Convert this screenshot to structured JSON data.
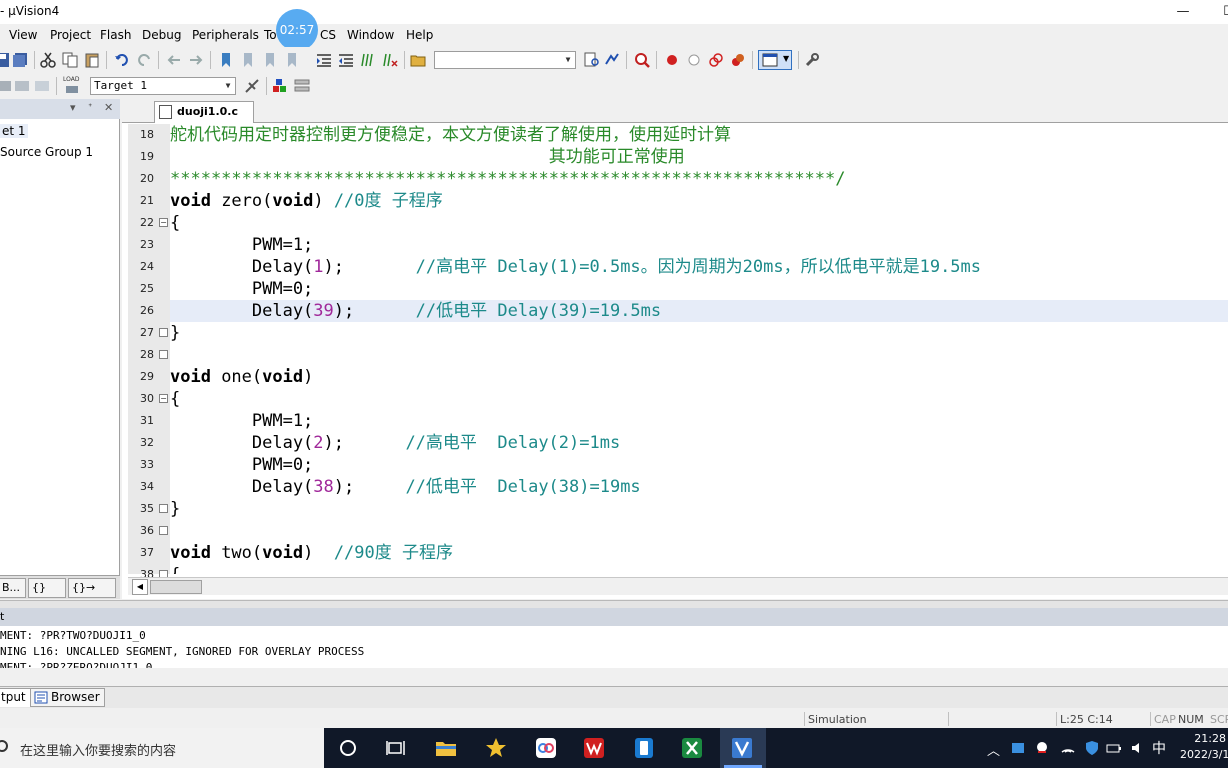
{
  "window": {
    "title": "- µVision4",
    "minimize": "—",
    "maximize": "☐"
  },
  "menu": [
    "View",
    "Project",
    "Flash",
    "Debug",
    "Peripherals",
    "To",
    "CS",
    "Window",
    "Help"
  ],
  "timer_badge": "02:57",
  "toolbar2": {
    "target_combo": "Target 1",
    "load_label": "LOAD"
  },
  "project_panel": {
    "tree": [
      "et 1",
      "Source Group 1"
    ],
    "tabs": [
      "B...",
      "{} F...",
      "{}→ Te..."
    ]
  },
  "editor": {
    "file_tab": "duoji1.0.c",
    "lines": [
      {
        "num": "18",
        "text": "舵机代码用定时器控制更方便稳定，本文方便读者了解使用，使用延时计算",
        "kind": "comment"
      },
      {
        "num": "19",
        "text": "                                     其功能可正常使用",
        "kind": "comment"
      },
      {
        "num": "20",
        "text": "*****************************************************************/",
        "kind": "comment"
      },
      {
        "num": "21",
        "code": [
          "void",
          " zero(",
          "void",
          ") "
        ],
        "tail": "//0度 子程序",
        "kind": "func"
      },
      {
        "num": "22",
        "text": "{",
        "kind": "plain"
      },
      {
        "num": "23",
        "text": "        PWM=1;",
        "kind": "plain"
      },
      {
        "num": "24",
        "text": "        Delay(1);       //高电平 Delay(1)=0.5ms。因为周期为20ms，所以低电平就是19.5ms",
        "kind": "plain"
      },
      {
        "num": "25",
        "text": "        PWM=0;",
        "kind": "plain"
      },
      {
        "num": "26",
        "text": "        Delay(39);      //低电平 Delay(39)=19.5ms",
        "kind": "plain"
      },
      {
        "num": "27",
        "text": "}",
        "kind": "plain"
      },
      {
        "num": "28",
        "text": "",
        "kind": "plain"
      },
      {
        "num": "29",
        "text": "void one(void)",
        "kind": "plain"
      },
      {
        "num": "30",
        "text": "{",
        "kind": "plain"
      },
      {
        "num": "31",
        "text": "        PWM=1;",
        "kind": "plain"
      },
      {
        "num": "32",
        "text": "        Delay(2);      //高电平  Delay(2)=1ms",
        "kind": "plain"
      },
      {
        "num": "33",
        "text": "        PWM=0;",
        "kind": "plain"
      },
      {
        "num": "34",
        "text": "        Delay(38);     //低电平  Delay(38)=19ms",
        "kind": "plain"
      },
      {
        "num": "35",
        "text": "}",
        "kind": "plain"
      },
      {
        "num": "36",
        "text": "",
        "kind": "plain"
      },
      {
        "num": "37",
        "text": "void two(void)  //90度 子程序",
        "kind": "plain"
      },
      {
        "num": "38",
        "text": "{",
        "kind": "plain"
      }
    ],
    "highlight_line": "26"
  },
  "output": {
    "header": "t",
    "lines": [
      "MENT: ?PR?TWO?DUOJI1_0",
      "NING L16: UNCALLED SEGMENT, IGNORED FOR OVERLAY PROCESS",
      "MENT: ?PR?ZERO?DUOJI1_0"
    ],
    "tabs": [
      "tput",
      "Browser"
    ]
  },
  "status": {
    "mode": "Simulation",
    "position": "L:25 C:14",
    "caps": "CAP",
    "num": "NUM",
    "scrl": "SCR"
  },
  "taskbar": {
    "search_placeholder": "在这里输入你要搜索的内容",
    "ime": "中",
    "time": "21:28",
    "date": "2022/3/1"
  },
  "colors": {
    "comment": "#2a8a2a",
    "cmt_teal": "#1d8a8a",
    "number": "#a0289a",
    "highlight": "#e6ecf8",
    "taskbar": "#101828"
  }
}
